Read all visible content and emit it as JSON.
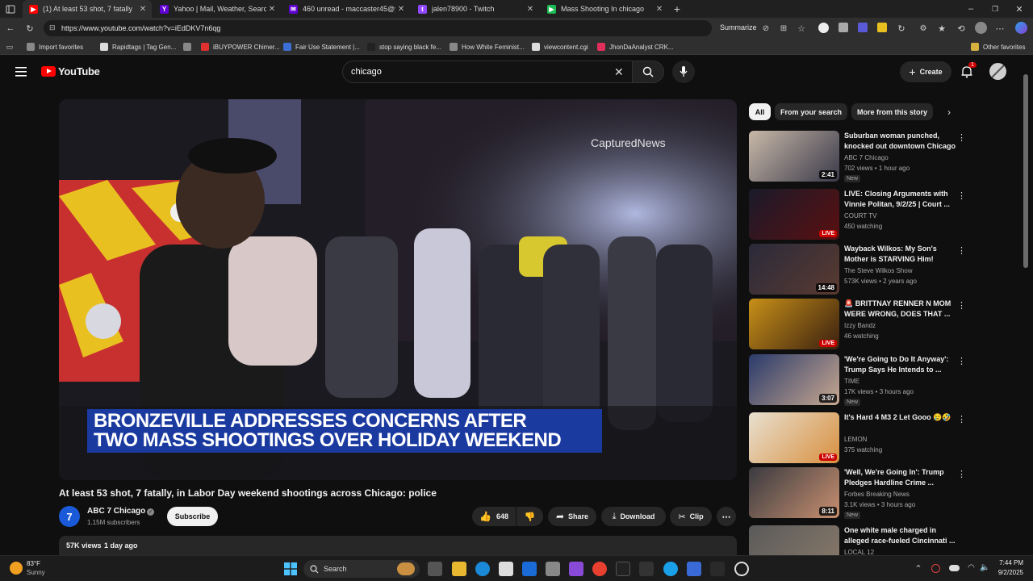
{
  "browser": {
    "tabs": [
      {
        "label": "(1) At least 53 shot, 7 fatally",
        "fav_color": "#ff0000",
        "fav_char": "▶"
      },
      {
        "label": "Yahoo | Mail, Weather, Search, Po",
        "fav_color": "#6001d2",
        "fav_char": "Y"
      },
      {
        "label": "460 unread - maccaster45@yaho",
        "fav_color": "#6001d2",
        "fav_char": "✉"
      },
      {
        "label": "jalen78900 - Twitch",
        "fav_color": "#9146ff",
        "fav_char": "t"
      },
      {
        "label": "Mass Shooting In chicago",
        "fav_color": "#1db954",
        "fav_char": "▶"
      }
    ],
    "url": "https://www.youtube.com/watch?v=iEdDKV7n6qg",
    "summarize_label": "Summarize",
    "bookmarks": [
      {
        "label": "Import favorites",
        "color": "#888888"
      },
      {
        "label": "Rapidtags | Tag Gen...",
        "color": "#dddddd"
      },
      {
        "label": "",
        "color": "#888888"
      },
      {
        "label": "iBUYPOWER Chimer...",
        "color": "#e03030"
      },
      {
        "label": "Fair Use Statement |...",
        "color": "#3b6fd6"
      },
      {
        "label": "stop saying black fe...",
        "color": "#222222"
      },
      {
        "label": "How White Feminist...",
        "color": "#888888"
      },
      {
        "label": "viewcontent.cgi",
        "color": "#dddddd"
      },
      {
        "label": "JhonDaAnalyst CRK...",
        "color": "#e0305a"
      }
    ],
    "other_favorites": "Other favorites"
  },
  "youtube": {
    "logo_text": "YouTube",
    "search_value": "chicago",
    "create_label": "Create",
    "notif_count": "1"
  },
  "video": {
    "watermark": "CapturedNews",
    "lower_third_line1": "BRONZEVILLE ADDRESSES CONCERNS AFTER",
    "lower_third_line2": "TWO MASS SHOOTINGS OVER HOLIDAY WEEKEND",
    "title": "At least 53 shot, 7 fatally, in Labor Day weekend shootings across Chicago: police",
    "channel": "ABC 7 Chicago",
    "avatar_text": "7",
    "subscribers": "1.15M subscribers",
    "subscribe_label": "Subscribe",
    "likes": "648",
    "share_label": "Share",
    "download_label": "Download",
    "clip_label": "Clip",
    "views": "57K views",
    "age": "1 day ago"
  },
  "chips": [
    "All",
    "From your search",
    "More from this story"
  ],
  "recommendations": [
    {
      "title": "Suburban woman punched, knocked out downtown Chicago",
      "channel": "ABC 7 Chicago",
      "meta": "702 views • 1 hour ago",
      "badge": "New",
      "duration": "2:41",
      "live": "",
      "colors": [
        "#c8b8a8",
        "#3a3a4a"
      ]
    },
    {
      "title": "LIVE: Closing Arguments with Vinnie Politan, 9/2/25 | Court ...",
      "channel": "COURT TV",
      "meta": "450 watching",
      "badge": "",
      "duration": "",
      "live": "LIVE",
      "colors": [
        "#1a1a2a",
        "#5a1010"
      ]
    },
    {
      "title": "Wayback Wilkos: My Son's Mother is STARVING Him!",
      "channel": "The Steve Wilkos Show",
      "meta": "573K views • 2 years ago",
      "badge": "",
      "duration": "14:48",
      "live": "",
      "colors": [
        "#2a2a3a",
        "#5a3a30"
      ]
    },
    {
      "title": "🚨 BRITTNAY RENNER N MOM WERE WRONG, DOES THAT ...",
      "channel": "Izzy Bandz",
      "meta": "46 watching",
      "badge": "",
      "duration": "",
      "live": "LIVE",
      "colors": [
        "#c89018",
        "#3a2010"
      ]
    },
    {
      "title": "'We're Going to Do It Anyway': Trump Says He Intends to ...",
      "channel": "TIME",
      "meta": "17K views • 3 hours ago",
      "badge": "New",
      "duration": "3:07",
      "live": "",
      "colors": [
        "#2a3a6a",
        "#c8a890"
      ]
    },
    {
      "title": "It's Hard 4 M3 2 Let Gooo 😢🤣",
      "channel": "LEMON",
      "meta": "375 watching",
      "badge": "",
      "duration": "",
      "live": "LIVE",
      "colors": [
        "#e8e0d0",
        "#d89040"
      ]
    },
    {
      "title": "'Well, We're Going In': Trump Pledges Hardline Crime ...",
      "channel": "Forbes Breaking News",
      "meta": "3.1K views • 3 hours ago",
      "badge": "New",
      "duration": "8:11",
      "live": "",
      "colors": [
        "#3a3a40",
        "#c89070"
      ]
    },
    {
      "title": "One white male charged in alleged race-fueled Cincinnati ...",
      "channel": "LOCAL 12",
      "meta": "",
      "badge": "",
      "duration": "",
      "live": "",
      "colors": [
        "#5a5a5a",
        "#8a7a6a"
      ]
    }
  ],
  "taskbar": {
    "weather_temp": "83°F",
    "weather_desc": "Sunny",
    "search_label": "Search",
    "time": "7:44 PM",
    "date": "9/2/2025"
  }
}
